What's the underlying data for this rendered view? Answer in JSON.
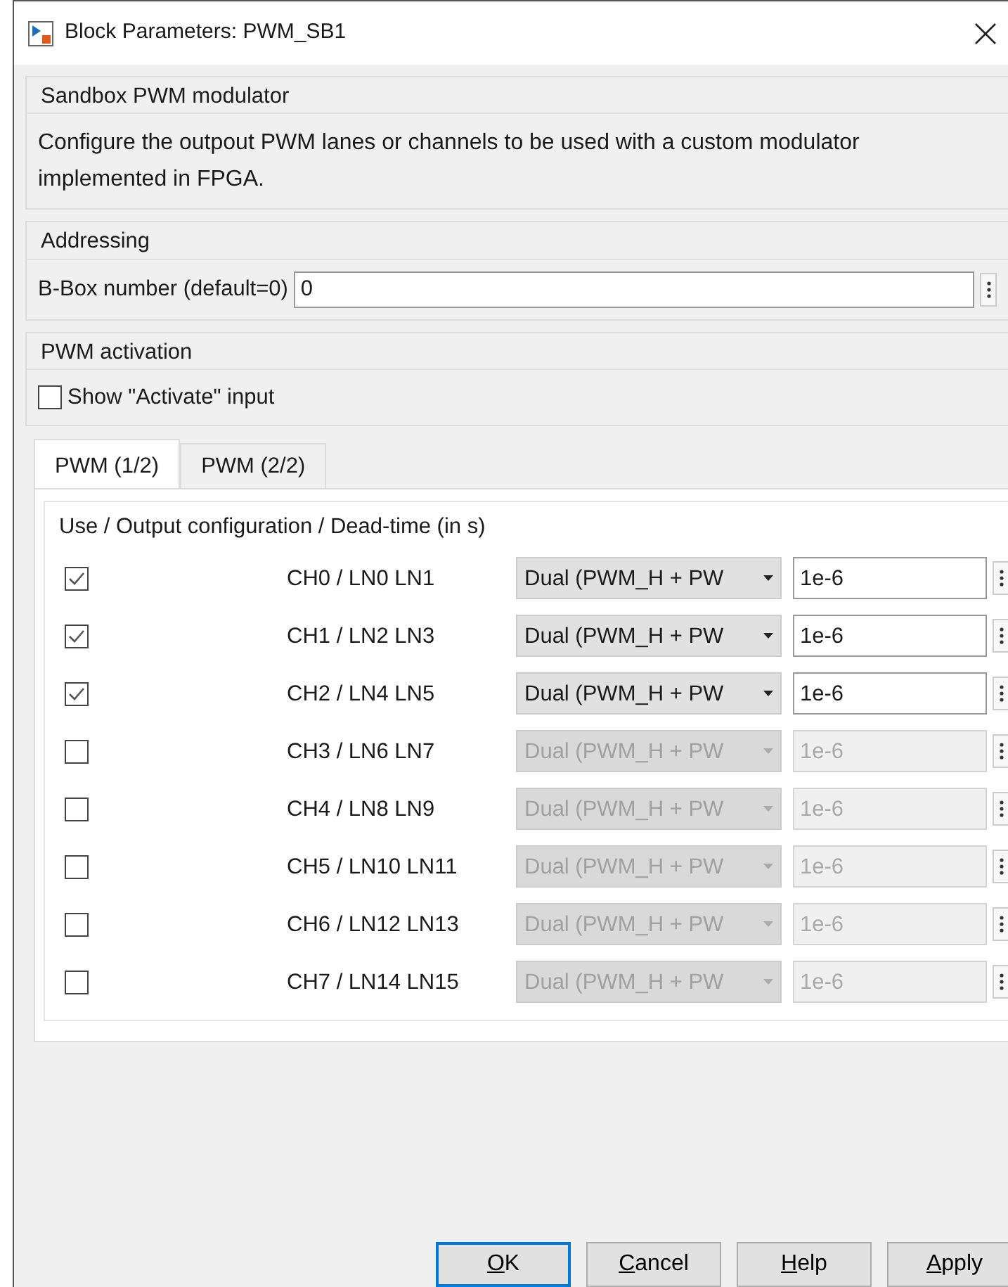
{
  "window": {
    "title": "Block Parameters: PWM_SB1"
  },
  "description_group": {
    "title": "Sandbox PWM modulator",
    "text": "Configure the outpout PWM lanes or channels to be used with a custom modulator implemented in FPGA."
  },
  "addressing": {
    "title": "Addressing",
    "label": "B-Box number (default=0)",
    "value": "0"
  },
  "activation": {
    "title": "PWM activation",
    "label": "Show \"Activate\" input",
    "checked": false
  },
  "tabs": [
    {
      "label": "PWM (1/2)",
      "selected": true
    },
    {
      "label": "PWM (2/2)",
      "selected": false
    }
  ],
  "panel": {
    "heading": "Use / Output configuration / Dead-time (in s)",
    "channels": [
      {
        "checked": true,
        "label": "CH0 / LN0 LN1",
        "mode": "Dual (PWM_H + PW",
        "dead_time": "1e-6",
        "disabled": false
      },
      {
        "checked": true,
        "label": "CH1 / LN2 LN3",
        "mode": "Dual (PWM_H + PW",
        "dead_time": "1e-6",
        "disabled": false
      },
      {
        "checked": true,
        "label": "CH2 / LN4 LN5",
        "mode": "Dual (PWM_H + PW",
        "dead_time": "1e-6",
        "disabled": false
      },
      {
        "checked": false,
        "label": "CH3 / LN6 LN7",
        "mode": "Dual (PWM_H + PW",
        "dead_time": "1e-6",
        "disabled": true
      },
      {
        "checked": false,
        "label": "CH4 / LN8 LN9",
        "mode": "Dual (PWM_H + PW",
        "dead_time": "1e-6",
        "disabled": true
      },
      {
        "checked": false,
        "label": "CH5 / LN10 LN11",
        "mode": "Dual (PWM_H + PW",
        "dead_time": "1e-6",
        "disabled": true
      },
      {
        "checked": false,
        "label": "CH6 / LN12 LN13",
        "mode": "Dual (PWM_H + PW",
        "dead_time": "1e-6",
        "disabled": true
      },
      {
        "checked": false,
        "label": "CH7 / LN14 LN15",
        "mode": "Dual (PWM_H + PW",
        "dead_time": "1e-6",
        "disabled": true
      }
    ]
  },
  "buttons": [
    {
      "key": "O",
      "rest": "K",
      "default": true
    },
    {
      "key": "C",
      "rest": "ancel",
      "default": false
    },
    {
      "key": "H",
      "rest": "elp",
      "default": false
    },
    {
      "key": "A",
      "rest": "pply",
      "default": false
    }
  ]
}
